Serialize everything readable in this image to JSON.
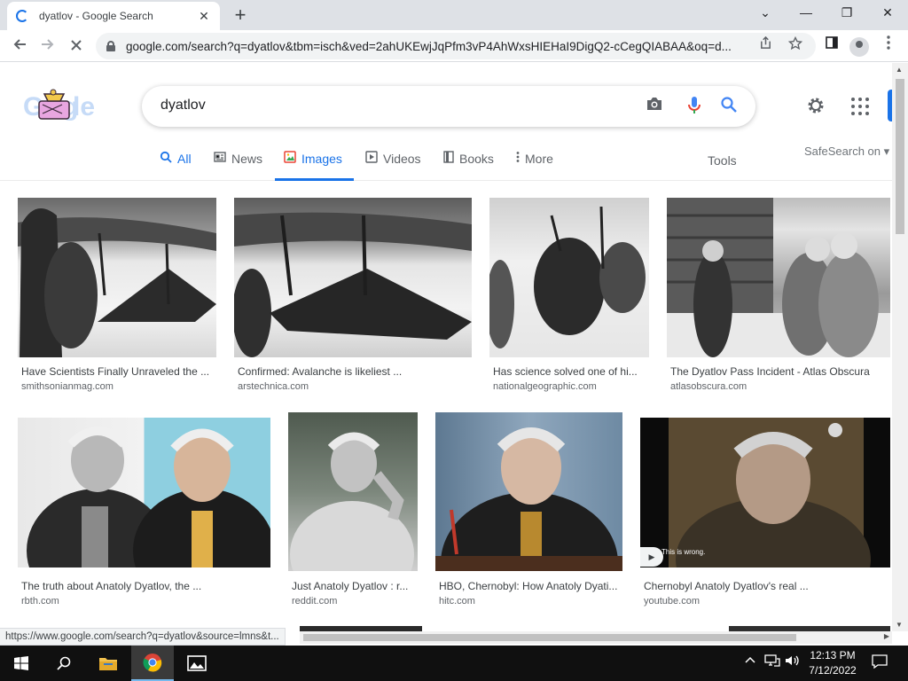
{
  "browser": {
    "tab_title": "dyatlov - Google Search",
    "tab_close": "✕",
    "new_tab": "+",
    "window_controls": {
      "tab_list": "⌄",
      "minimize": "—",
      "restore": "❐",
      "close": "✕"
    },
    "url": "google.com/search?q=dyatlov&tbm=isch&ved=2ahUKEwjJqPfm3vP4AhWxsHIEHaI9DigQ2-cCegQIABAA&oq=d...",
    "status_url": "https://www.google.com/search?q=dyatlov&source=lmns&t..."
  },
  "search": {
    "query": "dyatlov",
    "nav": [
      {
        "label": "All",
        "icon": "search-icon",
        "active": false
      },
      {
        "label": "News",
        "icon": "news-icon",
        "active": false
      },
      {
        "label": "Images",
        "icon": "image-icon",
        "active": true
      },
      {
        "label": "Videos",
        "icon": "play-icon",
        "active": false
      },
      {
        "label": "Books",
        "icon": "book-icon",
        "active": false
      },
      {
        "label": "More",
        "icon": "more-vert-icon",
        "active": false
      }
    ],
    "tools": "Tools",
    "safesearch": "SafeSearch on ▾"
  },
  "results": [
    {
      "title": "Have Scientists Finally Unraveled the ...",
      "source": "smithsonianmag.com"
    },
    {
      "title": "Confirmed: Avalanche is likeliest ...",
      "source": "arstechnica.com"
    },
    {
      "title": "Has science solved one of hi...",
      "source": "nationalgeographic.com"
    },
    {
      "title": "The Dyatlov Pass Incident - Atlas Obscura",
      "source": "atlasobscura.com"
    },
    {
      "title": "The truth about Anatoly Dyatlov, the ...",
      "source": "rbth.com"
    },
    {
      "title": "Just Anatoly Dyatlov : r...",
      "source": "reddit.com"
    },
    {
      "title": "HBO, Chernobyl: How Anatoly Dyati...",
      "source": "hitc.com"
    },
    {
      "title": "Chernobyl Anatoly Dyatlov's real ...",
      "source": "youtube.com",
      "overlay_text": "This is wrong."
    }
  ],
  "taskbar": {
    "time": "12:13 PM",
    "date": "7/12/2022"
  },
  "colors": {
    "accent": "#1a73e8",
    "chrome_bg": "#dee1e6",
    "taskbar_bg": "#101010"
  }
}
